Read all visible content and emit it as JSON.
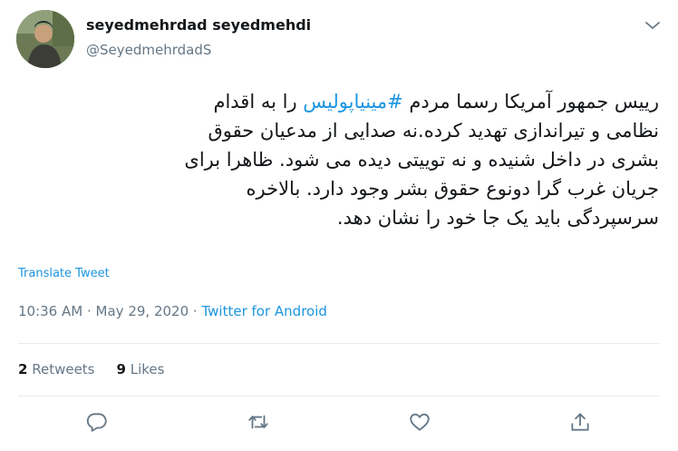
{
  "author": {
    "display_name": "seyedmehrdad seyedmehdi",
    "handle": "@SeyedmehrdadS",
    "avatar_icon": "profile-photo"
  },
  "tweet": {
    "lines": [
      [
        "رییس جمهور آمریکا رسما مردم ",
        "#مینیاپولیس",
        " را به اقدام"
      ],
      "نظامی و تیراندازی تهدید کرده.نه صدایی از مدعیان حقوق",
      "بشری در داخل شنیده و نه توییتی دیده می شود. ظاهرا برای",
      "جریان غرب گرا دونوع حقوق بشر وجود دارد. بالاخره",
      "سرسپردگی باید یک جا خود را نشان دهد."
    ],
    "hashtag_color": "#1b95e0"
  },
  "translate_label": "Translate Tweet",
  "meta": {
    "time": "10:36 AM",
    "date": "May 29, 2020",
    "separator": "·",
    "source": "Twitter for Android"
  },
  "stats": {
    "retweets_count": "2",
    "retweets_label": "Retweets",
    "likes_count": "9",
    "likes_label": "Likes"
  },
  "actions": {
    "icons": [
      "reply-icon",
      "retweet-icon",
      "like-icon",
      "share-icon"
    ]
  },
  "colors": {
    "text": "#14171a",
    "secondary": "#657786",
    "link": "#1b95e0",
    "divider": "#e6ecf0"
  }
}
